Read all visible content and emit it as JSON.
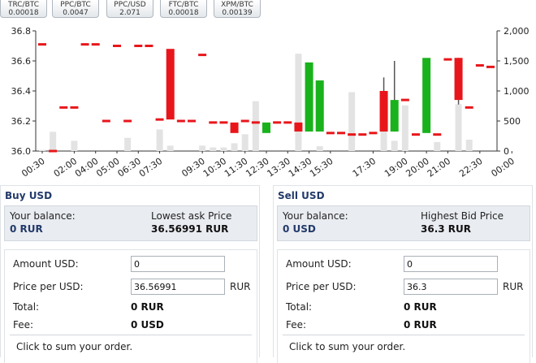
{
  "tickers": [
    {
      "pair": "TRC/BTC",
      "price": "0.00018"
    },
    {
      "pair": "PPC/BTC",
      "price": "0.0047"
    },
    {
      "pair": "PPC/USD",
      "price": "2.071"
    },
    {
      "pair": "FTC/BTC",
      "price": "0.00018"
    },
    {
      "pair": "XPM/BTC",
      "price": "0.00139"
    }
  ],
  "chart_data": {
    "type": "candlestick",
    "categories": [
      "00:30",
      "01:00",
      "01:30",
      "02:00",
      "02:30",
      "04:00",
      "04:30",
      "05:00",
      "05:30",
      "06:30",
      "07:00",
      "07:30",
      "08:00",
      "08:30",
      "09:00",
      "09:30",
      "10:00",
      "10:30",
      "11:00",
      "11:30",
      "12:00",
      "12:30",
      "13:00",
      "13:30",
      "14:00",
      "14:30",
      "15:00",
      "15:30",
      "16:00",
      "16:30",
      "17:00",
      "17:30",
      "18:00",
      "18:30",
      "19:00",
      "19:30",
      "20:00",
      "20:30",
      "21:00",
      "21:30",
      "22:00",
      "22:30",
      "23:00",
      "23:30",
      "00:00"
    ],
    "xtick_labels": [
      "00:30",
      "02:00",
      "04:00",
      "05:00",
      "06:30",
      "07:30",
      "09:30",
      "10:30",
      "11:30",
      "12:30",
      "13:30",
      "14:30",
      "15:30",
      "17:30",
      "19:00",
      "20:00",
      "21:00",
      "22:30",
      "00:00"
    ],
    "price_axis": {
      "ticks": [
        "36.0",
        "36.2",
        "36.4",
        "36.6",
        "36.8"
      ],
      "ylim": [
        36.0,
        36.8
      ]
    },
    "volume_axis": {
      "ticks": [
        "0",
        "500",
        "1,000",
        "1,500",
        "2,000"
      ],
      "ylim": [
        0,
        2000
      ]
    },
    "candles": [
      {
        "t": "00:30",
        "o": 36.71,
        "c": 36.71,
        "h": 36.71,
        "l": 36.71,
        "v": 20
      },
      {
        "t": "01:00",
        "o": 36.0,
        "c": 36.0,
        "h": 36.0,
        "l": 36.0,
        "v": 320
      },
      {
        "t": "01:30",
        "o": 36.29,
        "c": 36.29,
        "h": 36.29,
        "l": 36.29,
        "v": 0
      },
      {
        "t": "02:00",
        "o": 36.29,
        "c": 36.29,
        "h": 36.29,
        "l": 36.29,
        "v": 170
      },
      {
        "t": "02:30",
        "o": 36.71,
        "c": 36.71,
        "h": 36.71,
        "l": 36.71,
        "v": 0
      },
      {
        "t": "04:00",
        "o": 36.71,
        "c": 36.71,
        "h": 36.71,
        "l": 36.71,
        "v": 0
      },
      {
        "t": "04:30",
        "o": 36.2,
        "c": 36.2,
        "h": 36.2,
        "l": 36.2,
        "v": 0
      },
      {
        "t": "05:00",
        "o": 36.7,
        "c": 36.7,
        "h": 36.7,
        "l": 36.7,
        "v": 0
      },
      {
        "t": "05:30",
        "o": 36.2,
        "c": 36.2,
        "h": 36.2,
        "l": 36.2,
        "v": 220
      },
      {
        "t": "06:30",
        "o": 36.7,
        "c": 36.7,
        "h": 36.7,
        "l": 36.7,
        "v": 0
      },
      {
        "t": "07:00",
        "o": 36.7,
        "c": 36.7,
        "h": 36.7,
        "l": 36.7,
        "v": 0
      },
      {
        "t": "07:30",
        "o": 36.21,
        "c": 36.21,
        "h": 36.21,
        "l": 36.21,
        "v": 360
      },
      {
        "t": "08:00",
        "o": 36.68,
        "c": 36.21,
        "h": 36.68,
        "l": 36.21,
        "v": 90
      },
      {
        "t": "08:30",
        "o": 36.2,
        "c": 36.2,
        "h": 36.2,
        "l": 36.2,
        "v": 0
      },
      {
        "t": "09:00",
        "o": 36.2,
        "c": 36.2,
        "h": 36.2,
        "l": 36.2,
        "v": 0
      },
      {
        "t": "09:30",
        "o": 36.64,
        "c": 36.64,
        "h": 36.64,
        "l": 36.64,
        "v": 90
      },
      {
        "t": "10:00",
        "o": 36.19,
        "c": 36.19,
        "h": 36.19,
        "l": 36.19,
        "v": 60
      },
      {
        "t": "10:30",
        "o": 36.19,
        "c": 36.19,
        "h": 36.19,
        "l": 36.19,
        "v": 60
      },
      {
        "t": "11:00",
        "o": 36.19,
        "c": 36.12,
        "h": 36.19,
        "l": 36.12,
        "v": 130
      },
      {
        "t": "11:30",
        "o": 36.2,
        "c": 36.2,
        "h": 36.2,
        "l": 36.2,
        "v": 280
      },
      {
        "t": "12:00",
        "o": 36.19,
        "c": 36.19,
        "h": 36.19,
        "l": 36.19,
        "v": 830
      },
      {
        "t": "12:30",
        "o": 36.12,
        "c": 36.19,
        "h": 36.19,
        "l": 36.12,
        "v": 0
      },
      {
        "t": "13:00",
        "o": 36.19,
        "c": 36.19,
        "h": 36.19,
        "l": 36.19,
        "v": 0
      },
      {
        "t": "13:30",
        "o": 36.19,
        "c": 36.19,
        "h": 36.19,
        "l": 36.19,
        "v": 0
      },
      {
        "t": "14:00",
        "o": 36.19,
        "c": 36.13,
        "h": 36.19,
        "l": 36.13,
        "v": 1620
      },
      {
        "t": "14:30",
        "o": 36.13,
        "c": 36.59,
        "h": 36.59,
        "l": 36.13,
        "v": 0
      },
      {
        "t": "15:00",
        "o": 36.13,
        "c": 36.47,
        "h": 36.47,
        "l": 36.13,
        "v": 80
      },
      {
        "t": "15:30",
        "o": 36.12,
        "c": 36.12,
        "h": 36.12,
        "l": 36.12,
        "v": 0
      },
      {
        "t": "16:00",
        "o": 36.12,
        "c": 36.12,
        "h": 36.12,
        "l": 36.12,
        "v": 0
      },
      {
        "t": "16:30",
        "o": 36.11,
        "c": 36.11,
        "h": 36.11,
        "l": 36.11,
        "v": 980
      },
      {
        "t": "17:00",
        "o": 36.11,
        "c": 36.11,
        "h": 36.11,
        "l": 36.11,
        "v": 0
      },
      {
        "t": "17:30",
        "o": 36.12,
        "c": 36.12,
        "h": 36.12,
        "l": 36.12,
        "v": 0
      },
      {
        "t": "18:00",
        "o": 36.4,
        "c": 36.13,
        "h": 36.49,
        "l": 36.13,
        "v": 380
      },
      {
        "t": "18:30",
        "o": 36.13,
        "c": 36.34,
        "h": 36.6,
        "l": 36.13,
        "v": 170
      },
      {
        "t": "19:00",
        "o": 36.34,
        "c": 36.34,
        "h": 36.34,
        "l": 36.34,
        "v": 760
      },
      {
        "t": "19:30",
        "o": 36.11,
        "c": 36.11,
        "h": 36.11,
        "l": 36.11,
        "v": 0
      },
      {
        "t": "20:00",
        "o": 36.12,
        "c": 36.62,
        "h": 36.62,
        "l": 36.12,
        "v": 0
      },
      {
        "t": "20:30",
        "o": 36.11,
        "c": 36.11,
        "h": 36.11,
        "l": 36.11,
        "v": 150
      },
      {
        "t": "21:00",
        "o": 36.61,
        "c": 36.61,
        "h": 36.61,
        "l": 36.61,
        "v": 0
      },
      {
        "t": "21:30",
        "o": 36.62,
        "c": 36.34,
        "h": 36.62,
        "l": 36.31,
        "v": 780
      },
      {
        "t": "22:00",
        "o": 36.29,
        "c": 36.29,
        "h": 36.29,
        "l": 36.29,
        "v": 190
      },
      {
        "t": "22:30",
        "o": 36.57,
        "c": 36.57,
        "h": 36.57,
        "l": 36.57,
        "v": 0
      },
      {
        "t": "23:00",
        "o": 36.56,
        "c": 36.56,
        "h": 36.56,
        "l": 36.56,
        "v": 0
      }
    ],
    "grid": false,
    "colors": {
      "up": "#19b21c",
      "down": "#e8161b",
      "volume": "#e3e3e3",
      "wick": "#555555"
    }
  },
  "buy": {
    "title": "Buy USD",
    "balance_label": "Your balance:",
    "balance_value": "0 RUR",
    "price_label": "Lowest ask Price",
    "price_value": "36.56991 RUR",
    "amount_label": "Amount USD:",
    "amount_value": "0",
    "price_per_label": "Price per USD:",
    "price_per_value": "36.56991",
    "price_unit": "RUR",
    "total_label": "Total:",
    "total_value": "0 RUR",
    "fee_label": "Fee:",
    "fee_value": "0 USD",
    "hint": "Click to sum your order."
  },
  "sell": {
    "title": "Sell USD",
    "balance_label": "Your balance:",
    "balance_value": "0 USD",
    "price_label": "Highest Bid Price",
    "price_value": "36.3 RUR",
    "amount_label": "Amount USD:",
    "amount_value": "0",
    "price_per_label": "Price per USD:",
    "price_per_value": "36.3",
    "price_unit": "RUR",
    "total_label": "Total:",
    "total_value": "0 RUR",
    "fee_label": "Fee:",
    "fee_value": "0 RUR",
    "hint": "Click to sum your order."
  }
}
